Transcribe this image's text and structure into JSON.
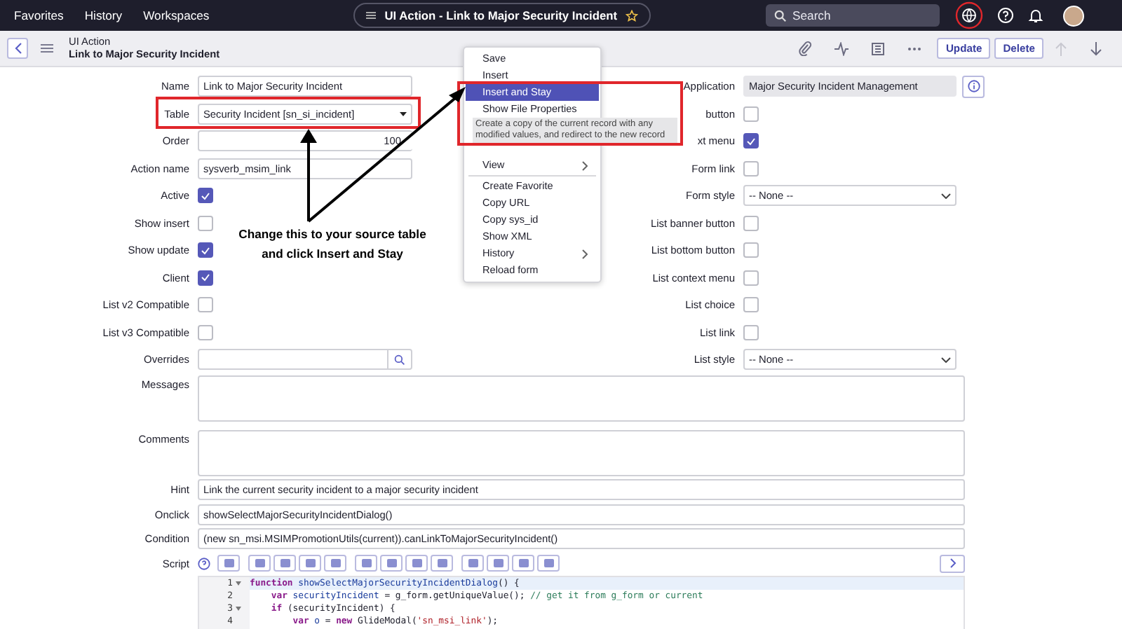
{
  "top_nav": {
    "links": [
      "Favorites",
      "History",
      "Workspaces"
    ],
    "title": "UI Action - Link to Major Security Incident",
    "search": {
      "placeholder": "Search"
    }
  },
  "header": {
    "type": "UI Action",
    "title": "Link to Major Security Incident",
    "buttons": [
      "Update",
      "Delete"
    ]
  },
  "left_fields": [
    {
      "label": "Name",
      "kind": "text",
      "value": "Link to Major Security Incident"
    },
    {
      "label": "Table",
      "kind": "select",
      "value": "Security Incident [sn_si_incident]"
    },
    {
      "label": "Order",
      "kind": "number",
      "value": "100"
    },
    {
      "label": "Action name",
      "kind": "text",
      "value": "sysverb_msim_link"
    },
    {
      "label": "Active",
      "kind": "checkbox",
      "checked": true
    },
    {
      "label": "Show insert",
      "kind": "checkbox",
      "checked": false
    },
    {
      "label": "Show update",
      "kind": "checkbox",
      "checked": true
    },
    {
      "label": "Client",
      "kind": "checkbox",
      "checked": true
    },
    {
      "label": "List v2 Compatible",
      "kind": "checkbox",
      "checked": false
    },
    {
      "label": "List v3 Compatible",
      "kind": "checkbox",
      "checked": false
    },
    {
      "label": "Overrides",
      "kind": "lookup"
    }
  ],
  "right_fields": [
    {
      "label": "Application",
      "kind": "readonly",
      "value": "Major Security Incident Management"
    },
    {
      "label": "button",
      "kind": "checkbox",
      "checked": false
    },
    {
      "label": "xt menu",
      "kind": "checkbox",
      "checked": true
    },
    {
      "label": "Form link",
      "kind": "checkbox",
      "checked": false
    },
    {
      "label": "Form style",
      "kind": "dropdown",
      "value": "-- None --"
    },
    {
      "label": "List banner button",
      "kind": "checkbox",
      "checked": false
    },
    {
      "label": "List bottom button",
      "kind": "checkbox",
      "checked": false
    },
    {
      "label": "List context menu",
      "kind": "checkbox",
      "checked": false
    },
    {
      "label": "List choice",
      "kind": "checkbox",
      "checked": false
    },
    {
      "label": "List link",
      "kind": "checkbox",
      "checked": false
    },
    {
      "label": "List style",
      "kind": "dropdown",
      "value": "-- None --"
    }
  ],
  "wide_fields": [
    {
      "label": "Messages",
      "kind": "textarea"
    },
    {
      "label": "Comments",
      "kind": "textarea"
    },
    {
      "label": "Hint",
      "kind": "text",
      "value": "Link the current security incident to a major security incident"
    },
    {
      "label": "Onclick",
      "kind": "text",
      "value": "showSelectMajorSecurityIncidentDialog()"
    },
    {
      "label": "Condition",
      "kind": "text",
      "value": "(new sn_msi.MSIMPromotionUtils(current)).canLinkToMajorSecurityIncident()"
    }
  ],
  "script": {
    "label": "Script",
    "lines": [
      {
        "n": "1",
        "fold": true,
        "tokens": [
          {
            "kind": "keyword",
            "text": "function "
          },
          {
            "kind": "def",
            "text": "showSelectMajorSecurityIncidentDialog"
          },
          {
            "kind": "plain",
            "text": "() {"
          }
        ]
      },
      {
        "n": "2",
        "fold": false,
        "tokens": [
          {
            "kind": "keyword",
            "text": "    var "
          },
          {
            "kind": "def",
            "text": "securityIncident"
          },
          {
            "kind": "plain",
            "text": " = g_form.getUniqueValue(); "
          },
          {
            "kind": "comment",
            "text": "// get it from g_form or current"
          }
        ]
      },
      {
        "n": "3",
        "fold": true,
        "tokens": [
          {
            "kind": "keyword",
            "text": "    if"
          },
          {
            "kind": "plain",
            "text": " (securityIncident) {"
          }
        ]
      },
      {
        "n": "4",
        "fold": false,
        "tokens": [
          {
            "kind": "keyword",
            "text": "        var "
          },
          {
            "kind": "def",
            "text": "o"
          },
          {
            "kind": "plain",
            "text": " = "
          },
          {
            "kind": "keyword",
            "text": "new "
          },
          {
            "kind": "plain",
            "text": "GlideModal("
          },
          {
            "kind": "string",
            "text": "'sn_msi_link'"
          },
          {
            "kind": "plain",
            "text": ");"
          }
        ]
      }
    ]
  },
  "menu": {
    "items_top": [
      {
        "label": "Save",
        "selected": false
      },
      {
        "label": "Insert",
        "selected": false
      },
      {
        "label": "Insert and Stay",
        "selected": true
      },
      {
        "label": "Show File Properties",
        "selected": false
      }
    ],
    "tooltip": "Create a copy of the current record with any modified values, and redirect to the new record",
    "items_bottom": [
      {
        "label": "View",
        "submenu": true,
        "divider_after": true
      },
      {
        "label": "Create Favorite",
        "submenu": false,
        "divider_after": false
      },
      {
        "label": "Copy URL",
        "submenu": false,
        "divider_after": false
      },
      {
        "label": "Copy sys_id",
        "submenu": false,
        "divider_after": false
      },
      {
        "label": "Show XML",
        "submenu": false,
        "divider_after": false
      },
      {
        "label": "History",
        "submenu": true,
        "divider_after": false
      },
      {
        "label": "Reload form",
        "submenu": false,
        "divider_after": false
      }
    ]
  },
  "annotation": {
    "lines": [
      "Change this to your source table",
      "and click Insert and Stay"
    ]
  }
}
